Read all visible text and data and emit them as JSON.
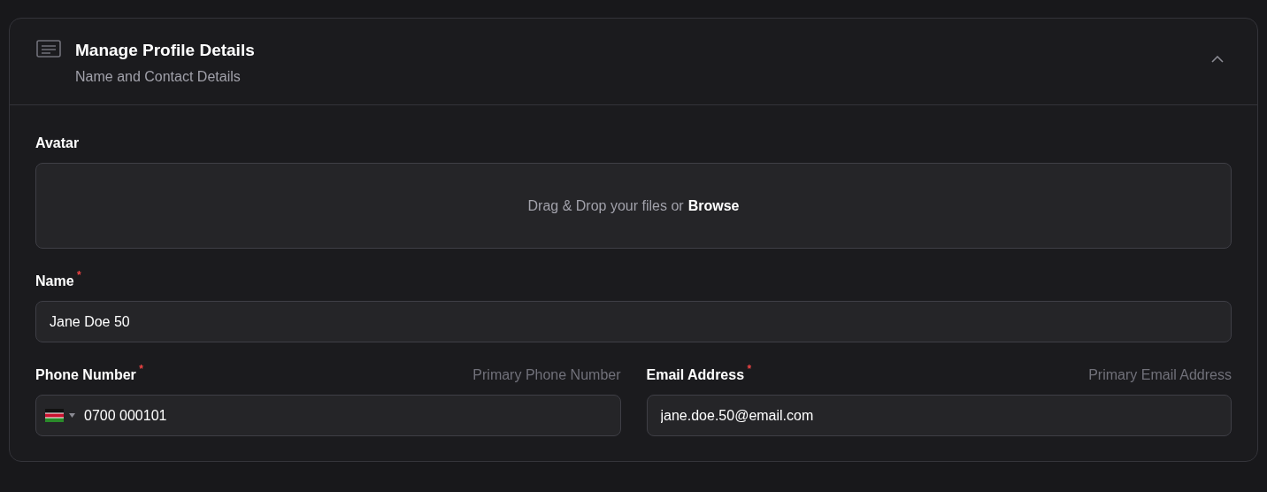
{
  "panel": {
    "title": "Manage Profile Details",
    "subtitle": "Name and Contact Details",
    "expanded": true
  },
  "avatar": {
    "label": "Avatar",
    "prompt": "Drag & Drop your files or",
    "link": "Browse"
  },
  "name": {
    "label": "Name",
    "required_mark": "*",
    "value": "Jane Doe 50"
  },
  "phone": {
    "label": "Phone Number",
    "required_mark": "*",
    "hint": "Primary Phone Number",
    "value": "0700 000101"
  },
  "email": {
    "label": "Email Address",
    "required_mark": "*",
    "hint": "Primary Email Address",
    "value": "jane.doe.50@email.com"
  }
}
